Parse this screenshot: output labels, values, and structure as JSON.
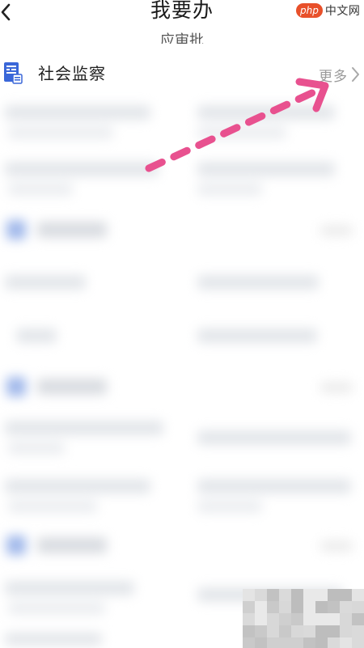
{
  "header": {
    "title": "我要办",
    "back_icon": "chevron-left-icon",
    "watermark_logo": "php",
    "watermark_text": "中文网"
  },
  "top_cut_text": "应审批",
  "section": {
    "icon": "supervision-doc-icon",
    "title": "社会监察",
    "more_label": "更多",
    "more_icon": "chevron-right-icon"
  },
  "annotation": {
    "type": "dashed-arrow",
    "color": "#e8518f",
    "points_to": "more-link"
  },
  "colors": {
    "accent_blue": "#3a67d8",
    "text_primary": "#222222",
    "text_muted": "#9a9a9a",
    "annotation_pink": "#e8518f"
  }
}
